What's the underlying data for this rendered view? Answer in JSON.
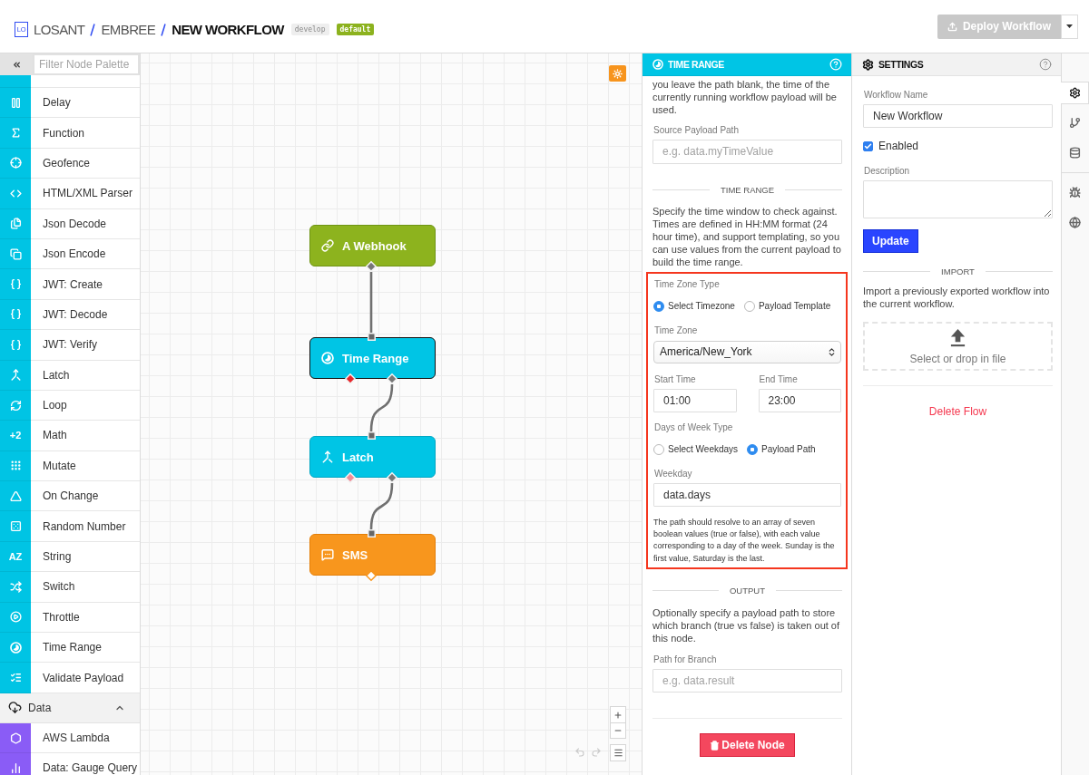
{
  "header": {
    "logo": "LO",
    "breadcrumb": [
      {
        "text": "LOSANT",
        "current": false
      },
      {
        "text": "EMBREE",
        "current": false
      },
      {
        "text": "NEW WORKFLOW",
        "current": true
      }
    ],
    "tags": [
      {
        "text": "develop",
        "kind": "version"
      },
      {
        "text": "default",
        "kind": "default"
      }
    ],
    "deploy_button": {
      "label": "Deploy Workflow",
      "disabled": true
    }
  },
  "palette": {
    "filter_placeholder": "Filter Node Palette",
    "groups": [
      {
        "color": "#00c4e4",
        "items": [
          {
            "kind": "cut"
          },
          {
            "kind": "node",
            "label": "Delay"
          },
          {
            "kind": "node",
            "label": "Function"
          },
          {
            "kind": "node",
            "label": "Geofence"
          },
          {
            "kind": "node",
            "label": "HTML/XML Parser"
          },
          {
            "kind": "node",
            "label": "Json Decode"
          },
          {
            "kind": "node",
            "label": "Json Encode"
          },
          {
            "kind": "node",
            "label": "JWT: Create"
          },
          {
            "kind": "node",
            "label": "JWT: Decode"
          },
          {
            "kind": "node",
            "label": "JWT: Verify"
          },
          {
            "kind": "node",
            "label": "Latch"
          },
          {
            "kind": "node",
            "label": "Loop"
          },
          {
            "kind": "node",
            "label": "Math",
            "icon_text": "+2"
          },
          {
            "kind": "node",
            "label": "Mutate"
          },
          {
            "kind": "node",
            "label": "On Change"
          },
          {
            "kind": "node",
            "label": "Random Number"
          },
          {
            "kind": "node",
            "label": "String",
            "icon_text": "AZ"
          },
          {
            "kind": "node",
            "label": "Switch"
          },
          {
            "kind": "node",
            "label": "Throttle"
          },
          {
            "kind": "node",
            "label": "Time Range"
          },
          {
            "kind": "node",
            "label": "Validate Payload"
          }
        ]
      },
      {
        "title": "Data",
        "expanded": true,
        "color": "#8a5cf6",
        "items": [
          {
            "kind": "node",
            "label": "AWS Lambda"
          },
          {
            "kind": "node",
            "label": "Data: Gauge Query"
          }
        ]
      }
    ]
  },
  "canvas": {
    "nodes": [
      {
        "label": "A Webhook",
        "kind": "trigger",
        "selected": false
      },
      {
        "label": "Time Range",
        "kind": "logic",
        "selected": true
      },
      {
        "label": "Latch",
        "kind": "logic",
        "selected": false
      },
      {
        "label": "SMS",
        "kind": "output",
        "selected": false
      }
    ],
    "undo_disabled": true,
    "redo_disabled": true
  },
  "node_panel": {
    "title": "TIME RANGE",
    "intro": "you leave the path blank, the time of the currently running workflow payload will be used.",
    "source_payload_path": {
      "label": "Source Payload Path",
      "placeholder": "e.g. data.myTimeValue"
    },
    "time_range": {
      "heading": "TIME RANGE",
      "description": "Specify the time window to check against. Times are defined in HH:MM format (24 hour time), and support templating, so you can use values from the current payload to build the time range.",
      "highlighted": true,
      "time_zone_type": {
        "label": "Time Zone Type",
        "options": [
          {
            "label": "Select Timezone",
            "selected": true
          },
          {
            "label": "Payload Template",
            "selected": false
          }
        ]
      },
      "time_zone": {
        "label": "Time Zone",
        "value": "America/New_York"
      },
      "start_time": {
        "label": "Start Time",
        "value": "01:00"
      },
      "end_time": {
        "label": "End Time",
        "value": "23:00"
      },
      "days_of_week_type": {
        "label": "Days of Week Type",
        "options": [
          {
            "label": "Select Weekdays",
            "selected": false
          },
          {
            "label": "Payload Path",
            "selected": true
          }
        ]
      },
      "weekday": {
        "label": "Weekday",
        "value": "data.days"
      },
      "help": "The path should resolve to an array of seven boolean values (true or false), with each value corresponding to a day of the week. Sunday is the first value, Saturday is the last."
    },
    "output": {
      "heading": "OUTPUT",
      "description": "Optionally specify a payload path to store which branch (true vs false) is taken out of this node.",
      "path_for_branch": {
        "label": "Path for Branch",
        "placeholder": "e.g. data.result"
      }
    },
    "delete_button": "Delete Node"
  },
  "settings_panel": {
    "title": "SETTINGS",
    "workflow_name": {
      "label": "Workflow Name",
      "value": "New Workflow"
    },
    "enabled": {
      "label": "Enabled",
      "checked": true
    },
    "description": {
      "label": "Description"
    },
    "update_button": "Update",
    "import": {
      "heading": "IMPORT",
      "description": "Import a previously exported workflow into the current workflow.",
      "dropzone": "Select or drop in file"
    },
    "delete_link": "Delete Flow"
  },
  "side_tabs": [
    {
      "tabs": [
        {
          "selected": true
        },
        {
          "selected": false
        },
        {
          "selected": false
        }
      ]
    },
    {
      "tabs": [
        {
          "selected": false
        },
        {
          "selected": false
        }
      ]
    }
  ]
}
